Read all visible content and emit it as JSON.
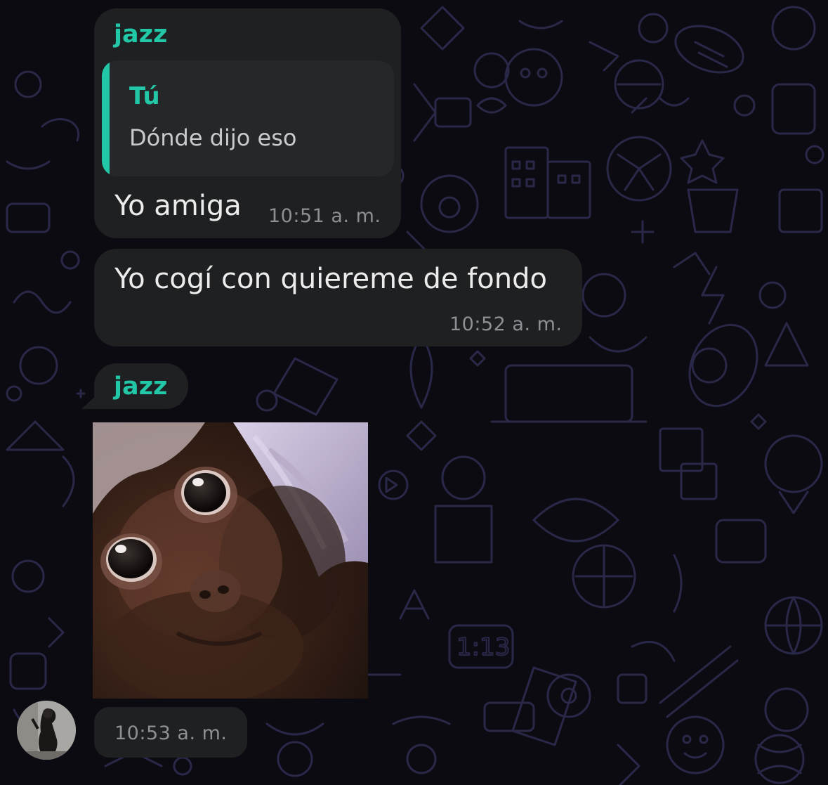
{
  "messages": [
    {
      "sender": "jazz",
      "quote": {
        "author": "Tú",
        "text": "Dónde dijo eso"
      },
      "text": "Yo amiga",
      "time": "10:51 a. m."
    },
    {
      "text": "Yo cogí con quiereme de fondo",
      "time": "10:52 a. m."
    },
    {
      "sender": "jazz",
      "image": "monkey-photo",
      "time": "10:53 a. m."
    }
  ],
  "colors": {
    "background": "#0c0b12",
    "bubble": "#1f2021",
    "accent": "#21c7a6",
    "time": "#8e9095",
    "doodle": "#2a2848"
  }
}
